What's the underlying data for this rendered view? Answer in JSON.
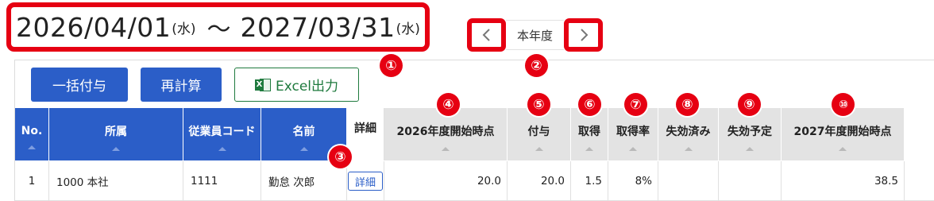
{
  "period": {
    "start_date": "2026/04/01",
    "start_weekday": "(水)",
    "separator": "〜",
    "end_date": "2027/03/31",
    "end_weekday": "(水)"
  },
  "year_nav": {
    "prev_icon": "chevron-left-icon",
    "label": "本年度",
    "next_icon": "chevron-right-icon"
  },
  "toolbar": {
    "bulk_grant_label": "一括付与",
    "recalc_label": "再計算",
    "excel_label": "Excel出力",
    "excel_icon": "excel-icon"
  },
  "annotations": [
    "①",
    "②",
    "③",
    "④",
    "⑤",
    "⑥",
    "⑦",
    "⑧",
    "⑨",
    "⑩"
  ],
  "table": {
    "columns": [
      "No.",
      "所属",
      "従業員コード",
      "名前",
      "詳細",
      "2026年度開始時点",
      "付与",
      "取得",
      "取得率",
      "失効済み",
      "失効予定",
      "2027年度開始時点"
    ],
    "rows": [
      {
        "no": "1",
        "dept": "1000 本社",
        "code": "1111",
        "name": "勤怠 次郎",
        "detail": "詳細",
        "start_balance": "20.0",
        "granted": "20.0",
        "taken": "1.5",
        "rate": "8%",
        "expired": "",
        "expiring": "",
        "end_balance": "38.5"
      }
    ]
  },
  "colors": {
    "accent_red": "#e60012",
    "primary_blue": "#2b5ec8",
    "excel_green": "#1f7a3e",
    "header_gray": "#e3e3e3"
  }
}
